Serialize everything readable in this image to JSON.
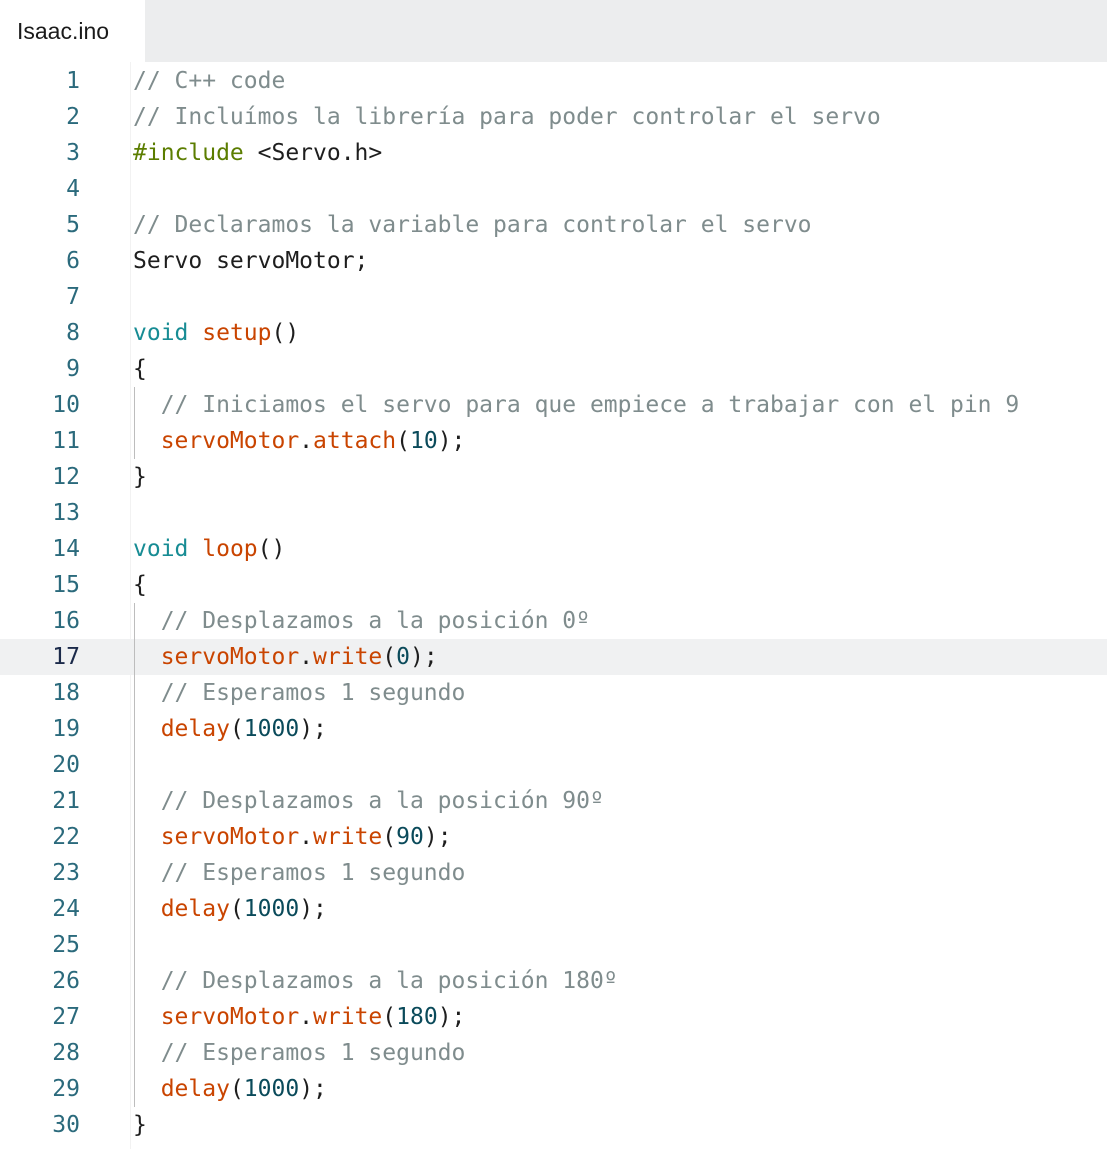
{
  "tab": {
    "label": "Isaac.ino"
  },
  "editor": {
    "active_line": 17,
    "lines": [
      {
        "n": "1",
        "tokens": [
          {
            "t": "// C++ code",
            "k": "comment"
          }
        ]
      },
      {
        "n": "2",
        "tokens": [
          {
            "t": "// Incluímos la librería para poder controlar el servo",
            "k": "comment"
          }
        ]
      },
      {
        "n": "3",
        "tokens": [
          {
            "t": "#include",
            "k": "pre"
          },
          {
            "t": " <Servo.h>",
            "k": "plain"
          }
        ]
      },
      {
        "n": "4",
        "tokens": []
      },
      {
        "n": "5",
        "tokens": [
          {
            "t": "// Declaramos la variable para controlar el servo",
            "k": "comment"
          }
        ]
      },
      {
        "n": "6",
        "tokens": [
          {
            "t": "Servo servoMotor;",
            "k": "plain"
          }
        ]
      },
      {
        "n": "7",
        "tokens": []
      },
      {
        "n": "8",
        "tokens": [
          {
            "t": "void",
            "k": "type"
          },
          {
            "t": " ",
            "k": "plain"
          },
          {
            "t": "setup",
            "k": "func"
          },
          {
            "t": "()",
            "k": "punct"
          }
        ]
      },
      {
        "n": "9",
        "tokens": [
          {
            "t": "{",
            "k": "punct"
          }
        ]
      },
      {
        "n": "10",
        "tokens": [
          {
            "t": "  // Iniciamos el servo para que empiece a trabajar con el pin 9",
            "k": "comment"
          }
        ]
      },
      {
        "n": "11",
        "tokens": [
          {
            "t": "  servoMotor",
            "k": "func"
          },
          {
            "t": ".",
            "k": "punct"
          },
          {
            "t": "attach",
            "k": "func"
          },
          {
            "t": "(",
            "k": "punct"
          },
          {
            "t": "10",
            "k": "num"
          },
          {
            "t": ");",
            "k": "punct"
          }
        ]
      },
      {
        "n": "12",
        "tokens": [
          {
            "t": "}",
            "k": "punct"
          }
        ]
      },
      {
        "n": "13",
        "tokens": []
      },
      {
        "n": "14",
        "tokens": [
          {
            "t": "void",
            "k": "type"
          },
          {
            "t": " ",
            "k": "plain"
          },
          {
            "t": "loop",
            "k": "func"
          },
          {
            "t": "()",
            "k": "punct"
          }
        ]
      },
      {
        "n": "15",
        "tokens": [
          {
            "t": "{",
            "k": "punct"
          }
        ]
      },
      {
        "n": "16",
        "tokens": [
          {
            "t": "  // Desplazamos a la posición 0º",
            "k": "comment"
          }
        ]
      },
      {
        "n": "17",
        "tokens": [
          {
            "t": "  servoMotor",
            "k": "func"
          },
          {
            "t": ".",
            "k": "punct"
          },
          {
            "t": "write",
            "k": "func"
          },
          {
            "t": "(",
            "k": "punct"
          },
          {
            "t": "0",
            "k": "num"
          },
          {
            "t": ");",
            "k": "punct"
          }
        ]
      },
      {
        "n": "18",
        "tokens": [
          {
            "t": "  // Esperamos 1 segundo",
            "k": "comment"
          }
        ]
      },
      {
        "n": "19",
        "tokens": [
          {
            "t": "  delay",
            "k": "func"
          },
          {
            "t": "(",
            "k": "punct"
          },
          {
            "t": "1000",
            "k": "num"
          },
          {
            "t": ");",
            "k": "punct"
          }
        ]
      },
      {
        "n": "20",
        "tokens": []
      },
      {
        "n": "21",
        "tokens": [
          {
            "t": "  // Desplazamos a la posición 90º",
            "k": "comment"
          }
        ]
      },
      {
        "n": "22",
        "tokens": [
          {
            "t": "  servoMotor",
            "k": "func"
          },
          {
            "t": ".",
            "k": "punct"
          },
          {
            "t": "write",
            "k": "func"
          },
          {
            "t": "(",
            "k": "punct"
          },
          {
            "t": "90",
            "k": "num"
          },
          {
            "t": ");",
            "k": "punct"
          }
        ]
      },
      {
        "n": "23",
        "tokens": [
          {
            "t": "  // Esperamos 1 segundo",
            "k": "comment"
          }
        ]
      },
      {
        "n": "24",
        "tokens": [
          {
            "t": "  delay",
            "k": "func"
          },
          {
            "t": "(",
            "k": "punct"
          },
          {
            "t": "1000",
            "k": "num"
          },
          {
            "t": ");",
            "k": "punct"
          }
        ]
      },
      {
        "n": "25",
        "tokens": []
      },
      {
        "n": "26",
        "tokens": [
          {
            "t": "  // Desplazamos a la posición 180º",
            "k": "comment"
          }
        ]
      },
      {
        "n": "27",
        "tokens": [
          {
            "t": "  servoMotor",
            "k": "func"
          },
          {
            "t": ".",
            "k": "punct"
          },
          {
            "t": "write",
            "k": "func"
          },
          {
            "t": "(",
            "k": "punct"
          },
          {
            "t": "180",
            "k": "num"
          },
          {
            "t": ");",
            "k": "punct"
          }
        ]
      },
      {
        "n": "28",
        "tokens": [
          {
            "t": "  // Esperamos 1 segundo",
            "k": "comment"
          }
        ]
      },
      {
        "n": "29",
        "tokens": [
          {
            "t": "  delay",
            "k": "func"
          },
          {
            "t": "(",
            "k": "punct"
          },
          {
            "t": "1000",
            "k": "num"
          },
          {
            "t": ");",
            "k": "punct"
          }
        ]
      },
      {
        "n": "30",
        "tokens": [
          {
            "t": "}",
            "k": "punct"
          }
        ]
      }
    ]
  },
  "colors": {
    "comment": "#7f8c8d",
    "preprocessor": "#5b7d00",
    "keyword": "#178c94",
    "function": "#c94400",
    "number": "#0a4a5a",
    "line_number": "#2b6a7c"
  }
}
